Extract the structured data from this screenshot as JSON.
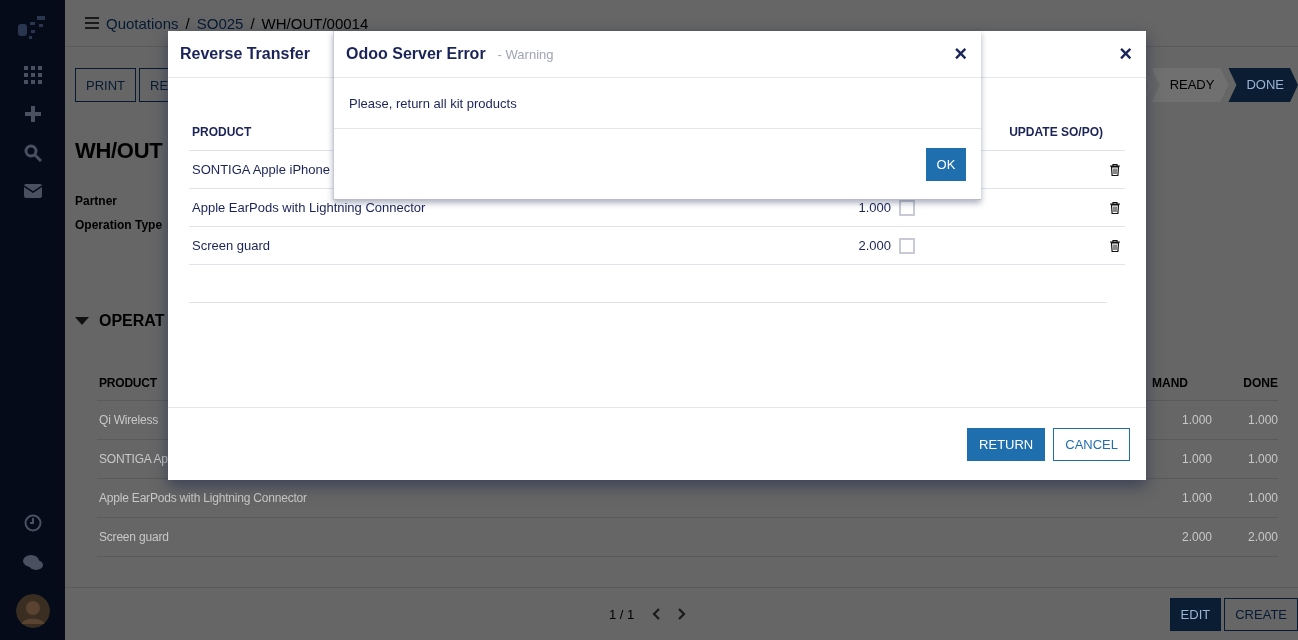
{
  "breadcrumb": [
    {
      "label": "Quotations",
      "kind": "link"
    },
    {
      "label": "/",
      "kind": "separator"
    },
    {
      "label": "SO025",
      "kind": "link"
    },
    {
      "label": "/",
      "kind": "separator"
    },
    {
      "label": "WH/OUT/00014",
      "kind": "current"
    }
  ],
  "control_buttons": [
    "PRINT",
    "RE"
  ],
  "status_steps": [
    {
      "label": "READY",
      "selected": false
    },
    {
      "label": "DONE",
      "selected": true
    }
  ],
  "record_title": "WH/OUT",
  "fields": [
    "Partner",
    "Operation Type"
  ],
  "section_title": "OPERAT",
  "operations": {
    "columns": [
      "PRODUCT",
      "MAND",
      "DONE"
    ],
    "rows": [
      {
        "product": "Qi Wireless",
        "demand": "1.000",
        "done": "1.000"
      },
      {
        "product": "SONTIGA Ap",
        "demand": "1.000",
        "done": "1.000"
      },
      {
        "product": "Apple EarPods with Lightning Connector",
        "demand": "1.000",
        "done": "1.000"
      },
      {
        "product": "Screen guard",
        "demand": "2.000",
        "done": "2.000"
      }
    ]
  },
  "pager": "1 / 1",
  "footer_buttons": [
    {
      "label": "EDIT",
      "primary": true
    },
    {
      "label": "CREATE",
      "primary": false
    }
  ],
  "reverse_dialog": {
    "title": "Reverse Transfer",
    "close": "×",
    "columns": [
      "PRODUCT",
      "UPDATE SO/PO)"
    ],
    "rows": [
      {
        "product": "SONTIGA Apple iPhone"
      },
      {
        "product": "Apple EarPods with Lightning Connector",
        "quantity": "1.000",
        "checked": false
      },
      {
        "product": "Screen guard",
        "quantity": "2.000",
        "checked": false
      }
    ],
    "buttons": [
      {
        "label": "RETURN",
        "primary": true
      },
      {
        "label": "CANCEL",
        "primary": false
      }
    ]
  },
  "error_dialog": {
    "title": "Odoo Server Error",
    "subtitle": "- Warning",
    "close": "×",
    "message": "Please, return all kit products",
    "button": "OK"
  }
}
